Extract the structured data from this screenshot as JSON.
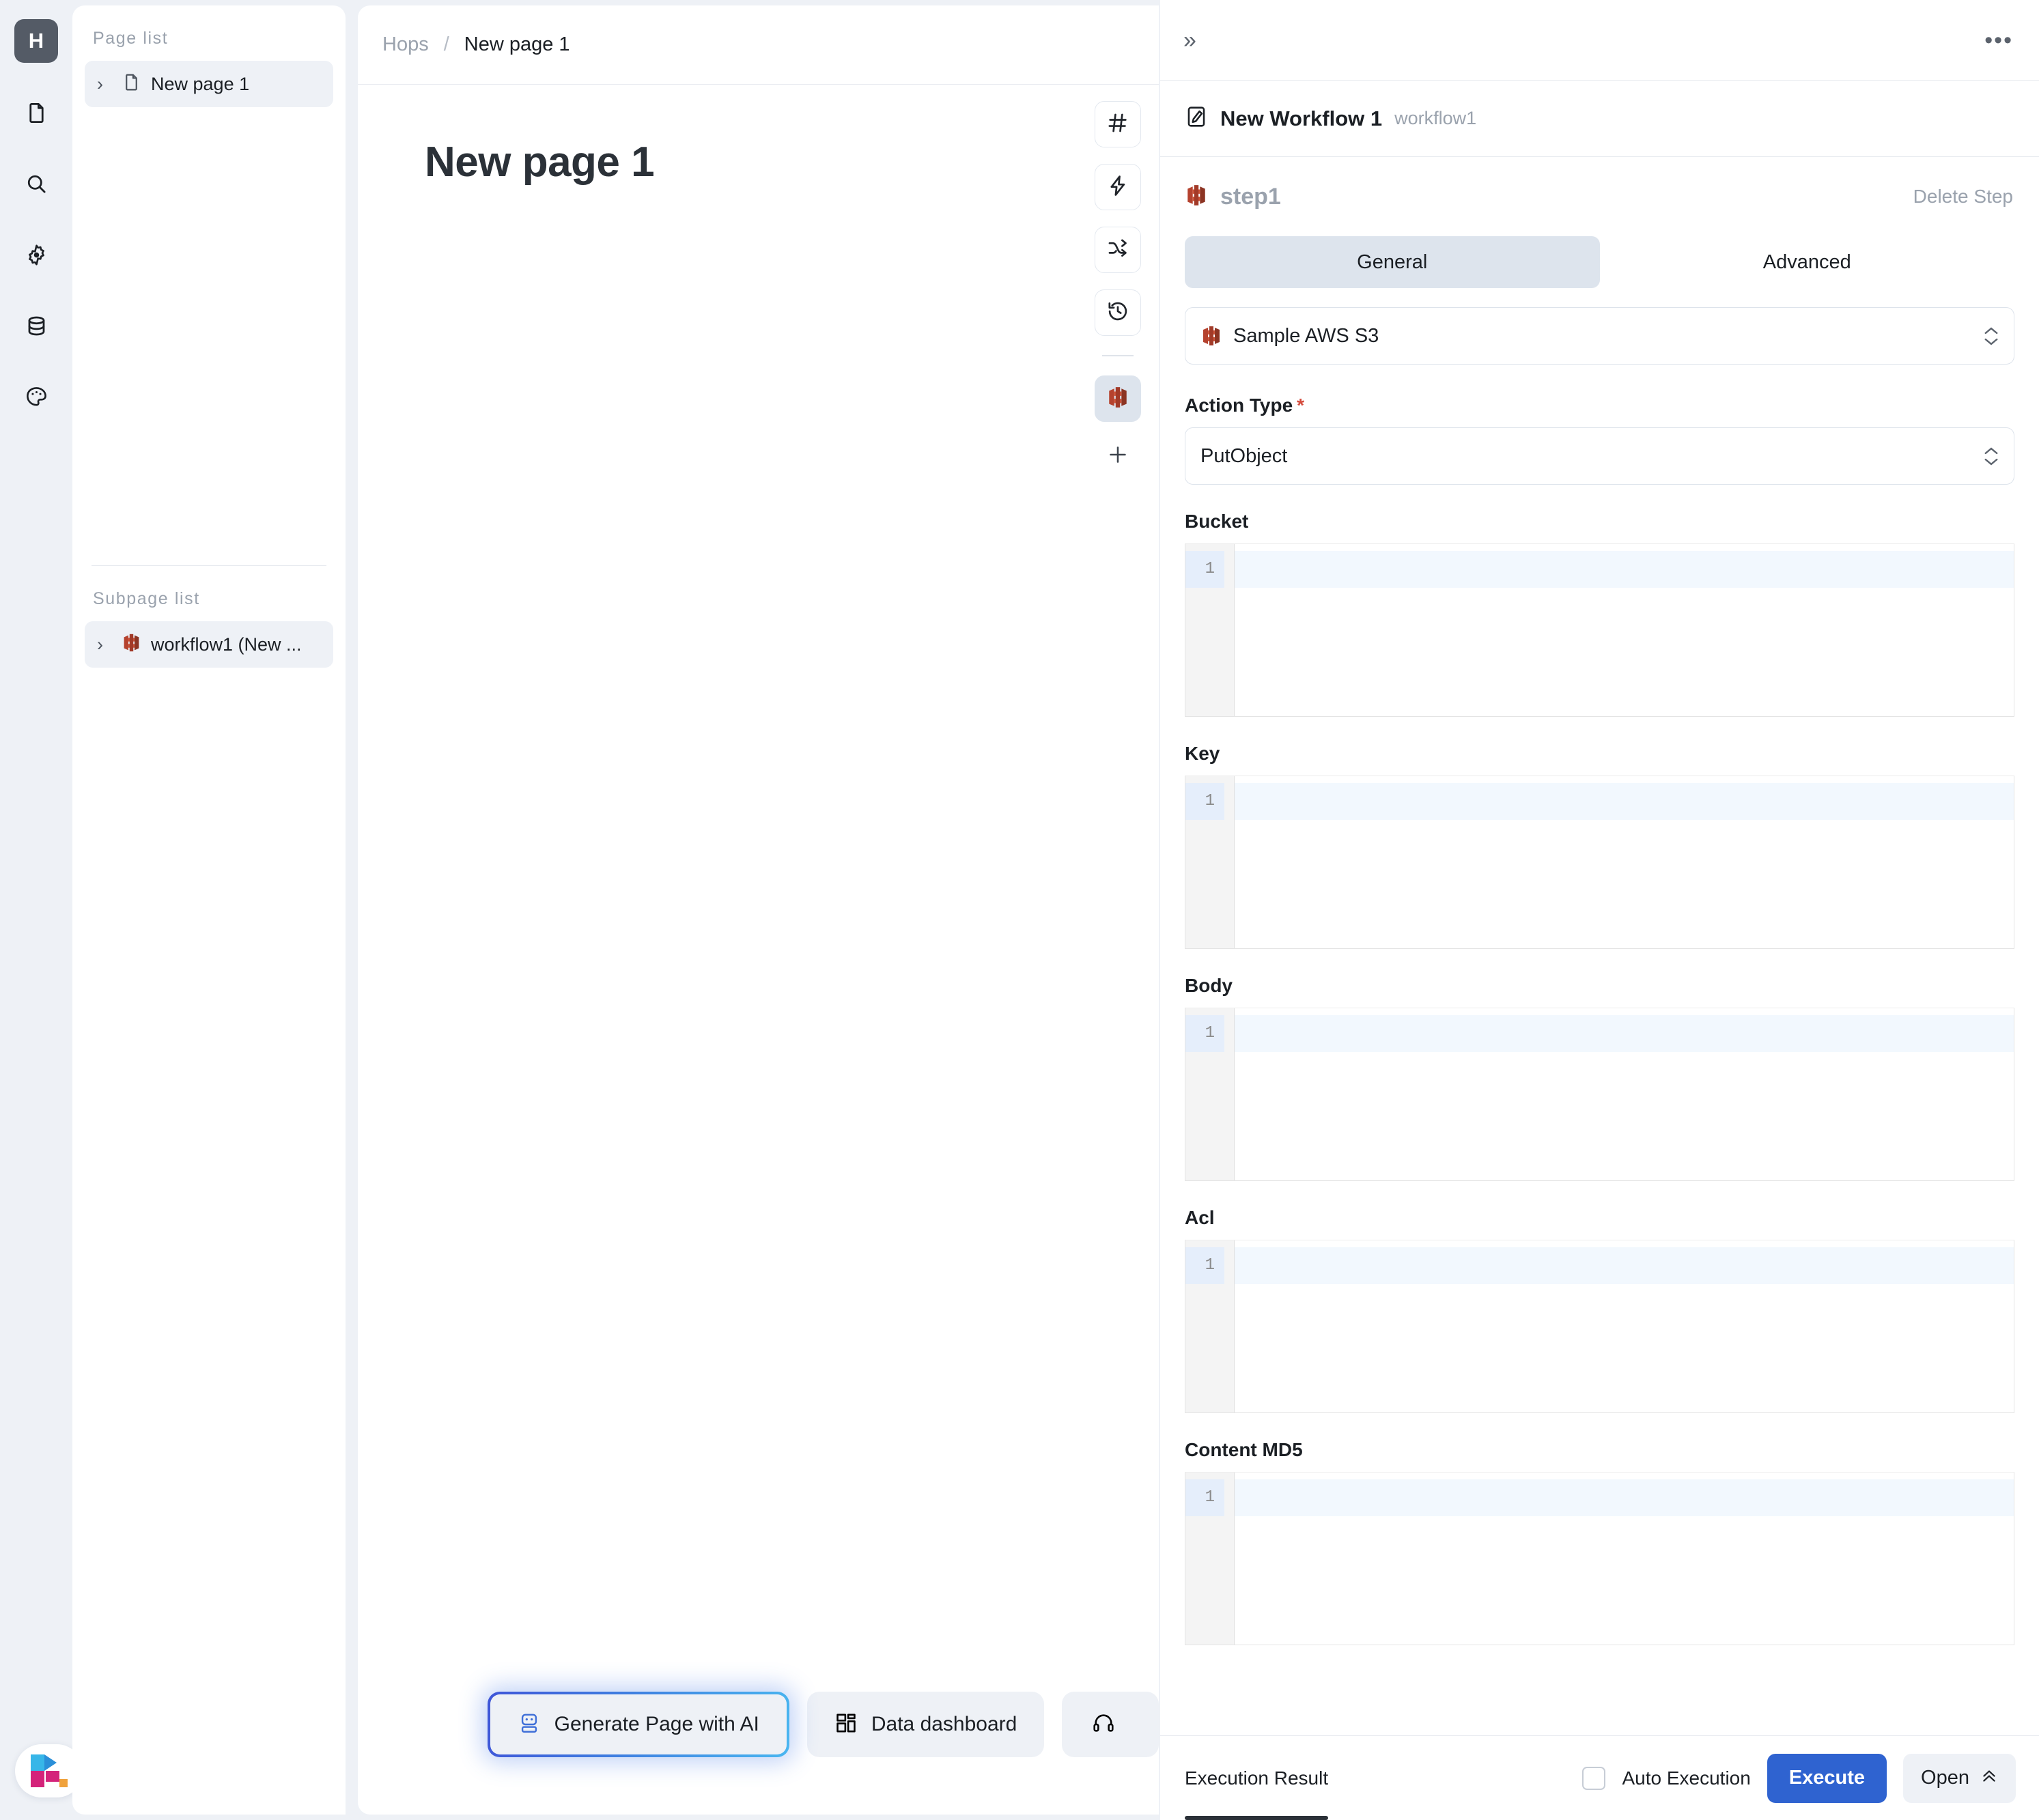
{
  "app": {
    "logo_letter": "H"
  },
  "rail": {
    "items": [
      {
        "icon": "file-icon",
        "name": "rail-item-pages"
      },
      {
        "icon": "search-icon",
        "name": "rail-item-search"
      },
      {
        "icon": "gear-icon",
        "name": "rail-item-settings"
      },
      {
        "icon": "database-icon",
        "name": "rail-item-data"
      },
      {
        "icon": "palette-icon",
        "name": "rail-item-theme"
      }
    ]
  },
  "pagelist": {
    "page_list_label": "Page list",
    "pages": [
      {
        "label": "New page 1",
        "icon": "file-icon",
        "selected": true
      }
    ],
    "subpage_list_label": "Subpage list",
    "subpages": [
      {
        "label": "workflow1 (New ...",
        "icon": "aws-s3-icon",
        "selected": true
      }
    ]
  },
  "breadcrumb": {
    "root": "Hops",
    "separator": "/",
    "current": "New page 1"
  },
  "canvas": {
    "title": "New page 1",
    "tools": [
      {
        "icon": "hash-icon",
        "name": "tool-variables",
        "active": false
      },
      {
        "icon": "bolt-icon",
        "name": "tool-events",
        "active": false
      },
      {
        "icon": "shuffle-icon",
        "name": "tool-workflows",
        "active": false
      },
      {
        "icon": "history-icon",
        "name": "tool-history",
        "active": false
      },
      {
        "icon": "aws-s3-icon",
        "name": "tool-aws-s3",
        "active": true
      }
    ],
    "add_label": "+",
    "actions": [
      {
        "label": "Generate Page with AI",
        "icon": "robot-icon",
        "highlighted": true
      },
      {
        "label": "Data dashboard",
        "icon": "dashboard-icon",
        "highlighted": false
      },
      {
        "label": "",
        "icon": "support-icon",
        "highlighted": false
      }
    ]
  },
  "inspector": {
    "collapse_icon": "»",
    "more_icon": "•••",
    "workflow": {
      "name": "New Workflow 1",
      "slug": "workflow1",
      "icon": "edit-square-icon"
    },
    "step": {
      "name": "step1",
      "icon": "aws-s3-icon",
      "delete_label": "Delete Step"
    },
    "tabs": [
      {
        "label": "General",
        "active": true
      },
      {
        "label": "Advanced",
        "active": false
      }
    ],
    "resource": {
      "value": "Sample AWS S3",
      "icon": "aws-s3-icon"
    },
    "action_type": {
      "label": "Action Type",
      "required": true,
      "value": "PutObject"
    },
    "fields": [
      {
        "label": "Bucket",
        "value": "",
        "line_number": "1"
      },
      {
        "label": "Key",
        "value": "",
        "line_number": "1"
      },
      {
        "label": "Body",
        "value": "",
        "line_number": "1"
      },
      {
        "label": "Acl",
        "value": "",
        "line_number": "1"
      },
      {
        "label": "Content MD5",
        "value": "",
        "line_number": "1"
      }
    ],
    "footer": {
      "result_tab": "Execution Result",
      "auto_execution": "Auto Execution",
      "auto_execution_checked": false,
      "execute": "Execute",
      "open": "Open"
    }
  },
  "colors": {
    "accent_blue": "#2f63d0",
    "aws_red": "#b5422e",
    "required_red": "#d44a3b",
    "app_bg": "#eef1f6",
    "panel_bg": "#ffffff",
    "muted_text": "#9aa2ad"
  }
}
